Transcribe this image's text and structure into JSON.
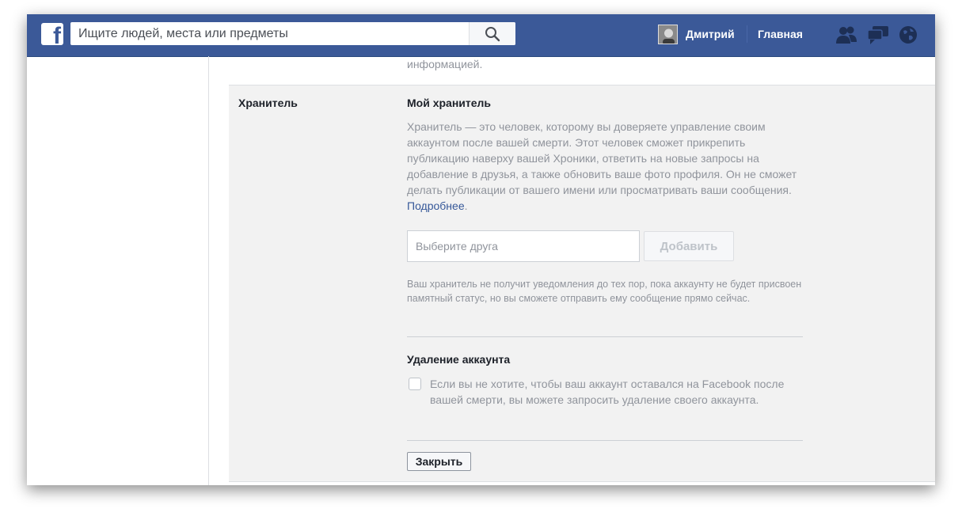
{
  "header": {
    "search_placeholder": "Ищите людей, места или предметы",
    "user_name": "Дмитрий",
    "home_label": "Главная",
    "icons": [
      "facebook-logo-icon",
      "search-icon",
      "friend-requests-icon",
      "messages-icon",
      "notifications-globe-icon"
    ]
  },
  "section": {
    "top_text_fragment": "информацией.",
    "label": "Хранитель",
    "heading": "Мой хранитель",
    "description": "Хранитель — это человек, которому вы доверяете управление своим аккаунтом после вашей смерти. Этот человек сможет прикрепить публикацию наверху вашей Хроники, ответить на новые запросы на добавление в друзья, а также обновить ваше фото профиля. Он не сможет делать публикации от вашего имени или просматривать ваши сообщения.",
    "learn_more_link": "Подробнее",
    "friend_input_placeholder": "Выберите друга",
    "add_button": "Добавить",
    "note": "Ваш хранитель не получит уведомления до тех пор, пока аккаунту не будет присвоен памятный статус, но вы сможете отправить ему сообщение прямо сейчас.",
    "deletion_heading": "Удаление аккаунта",
    "deletion_checkbox_text": "Если вы не хотите, чтобы ваш аккаунт оставался на Facebook после вашей смерти, вы можете запросить удаление своего аккаунта.",
    "deletion_checked": false,
    "close_button": "Закрыть"
  },
  "colors": {
    "brand": "#3b5998",
    "link": "#365899",
    "muted_text": "#90949c",
    "panel_bg": "#f2f2f2"
  }
}
